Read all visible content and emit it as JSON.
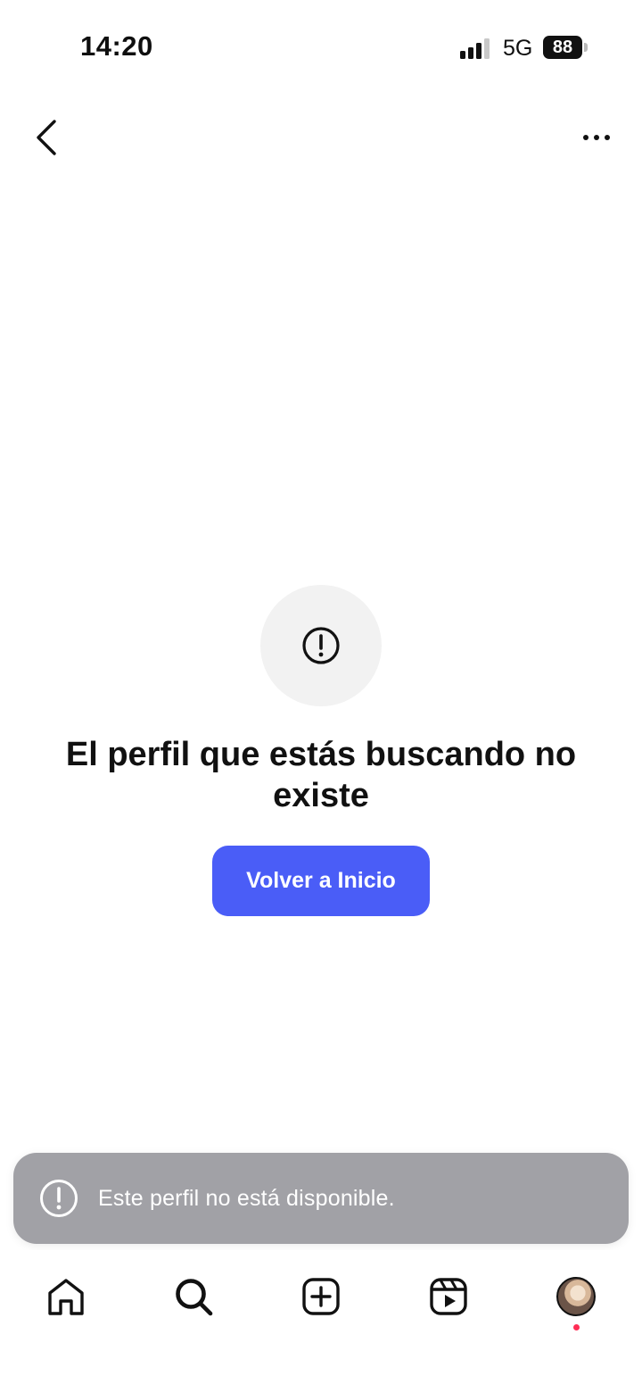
{
  "status_bar": {
    "time": "14:20",
    "network": "5G",
    "battery": "88"
  },
  "top_nav": {
    "back_icon": "chevron-left-icon",
    "more_icon": "more-horizontal-icon"
  },
  "content": {
    "alert_icon": "alert-circle-icon",
    "title": "El perfil que estás buscando no existe",
    "home_button_label": "Volver a Inicio"
  },
  "toast": {
    "icon": "alert-circle-icon",
    "message": "Este perfil no está disponible."
  },
  "bottom_nav": {
    "items": [
      {
        "icon": "home-icon"
      },
      {
        "icon": "search-icon"
      },
      {
        "icon": "create-post-icon"
      },
      {
        "icon": "reels-icon"
      },
      {
        "icon": "profile-avatar"
      }
    ]
  },
  "colors": {
    "primary_button": "#4a5df7",
    "toast_bg": "#a1a1a6",
    "notification_dot": "#ff2d55"
  }
}
